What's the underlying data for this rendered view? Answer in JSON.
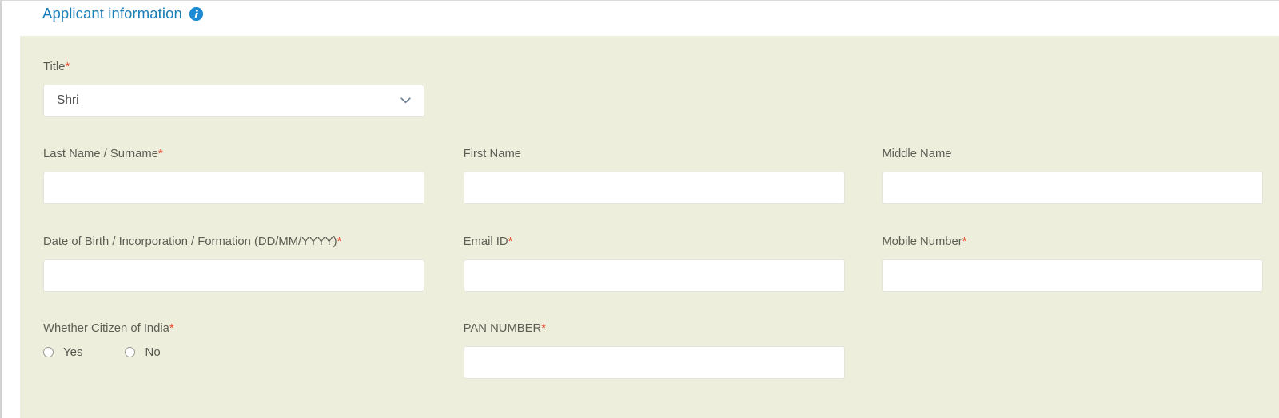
{
  "section": {
    "title": "Applicant information",
    "info_icon": "info-circle-icon",
    "accent_color": "#1b7fb8",
    "info_icon_color": "#1f8ad4",
    "panel_color": "#eeeedd",
    "required_marker": "*",
    "required_color": "#e8472c"
  },
  "fields": {
    "title": {
      "label": "Title",
      "required": "*",
      "value": "Shri",
      "chevron_icon": "chevron-down-icon"
    },
    "last_name": {
      "label": "Last Name / Surname",
      "required": "*",
      "value": "",
      "placeholder": ""
    },
    "first_name": {
      "label": "First Name",
      "required": "",
      "value": "",
      "placeholder": ""
    },
    "middle_name": {
      "label": "Middle Name",
      "required": "",
      "value": "",
      "placeholder": ""
    },
    "dob": {
      "label": "Date of Birth / Incorporation / Formation (DD/MM/YYYY)",
      "required": "*",
      "value": "",
      "placeholder": ""
    },
    "email": {
      "label": "Email ID",
      "required": "*",
      "value": "",
      "placeholder": ""
    },
    "mobile": {
      "label": "Mobile Number",
      "required": "*",
      "value": "",
      "placeholder": ""
    },
    "citizen": {
      "label": "Whether Citizen of India",
      "required": "*",
      "options": [
        {
          "label": "Yes",
          "selected": false
        },
        {
          "label": "No",
          "selected": false
        }
      ]
    },
    "pan": {
      "label": "PAN NUMBER",
      "required": "*",
      "value": "",
      "placeholder": ""
    }
  }
}
